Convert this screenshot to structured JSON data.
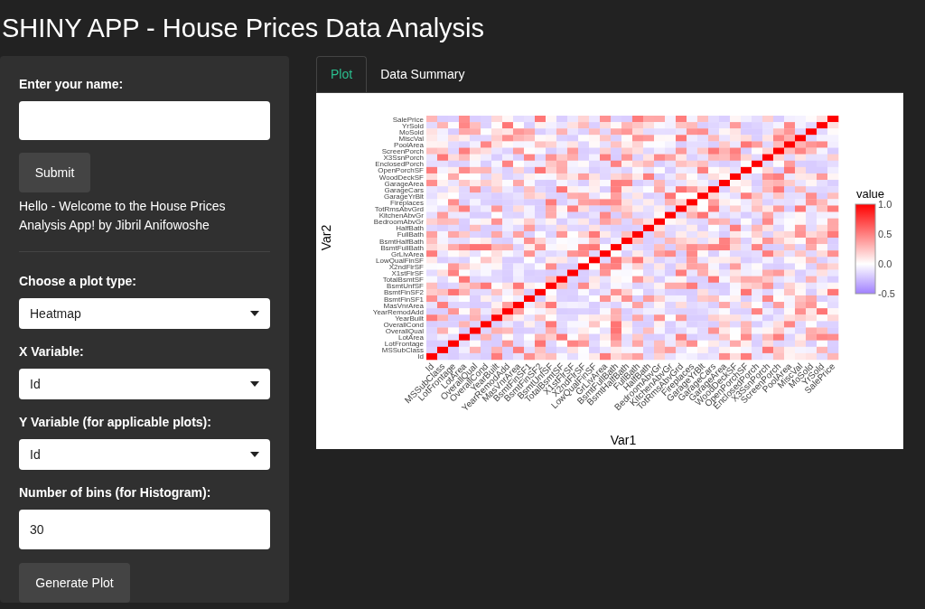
{
  "title": "SHINY APP - House Prices Data Analysis",
  "sidebar": {
    "name_label": "Enter your name:",
    "submit": "Submit",
    "greeting": "Hello - Welcome to the House Prices Analysis App! by Jibril Anifowoshe",
    "controls": [
      {
        "kind": "select",
        "label": "Choose a plot type:",
        "value": "Heatmap"
      },
      {
        "kind": "select",
        "label": "X Variable:",
        "value": "Id"
      },
      {
        "kind": "select",
        "label": "Y Variable (for applicable plots):",
        "value": "Id"
      },
      {
        "kind": "input",
        "label": "Number of bins (for Histogram):",
        "value": "30"
      }
    ],
    "generate": "Generate Plot"
  },
  "tabs": [
    {
      "label": "Plot",
      "selected": true
    },
    {
      "label": "Data Summary",
      "selected": false
    }
  ],
  "heatmap": {
    "xlabel": "Var1",
    "ylabel": "Var2",
    "legend_title": "value",
    "legend_ticks": [
      "1.0",
      "0.5",
      "0.0",
      "-0.5"
    ],
    "y_labels": [
      "SalePrice",
      "YrSold",
      "MoSold",
      "MiscVal",
      "PoolArea",
      "ScreenPorch",
      "X3SsnPorch",
      "EnclosedPorch",
      "OpenPorchSF",
      "WoodDeckSF",
      "GarageArea",
      "GarageCars",
      "GarageYrBlt",
      "Fireplaces",
      "TotRmsAbvGrd",
      "KitchenAbvGr",
      "BedroomAbvGr",
      "HalfBath",
      "FullBath",
      "BsmtHalfBath",
      "BsmtFullBath",
      "GrLivArea",
      "LowQualFinSF",
      "X2ndFlrSF",
      "X1stFlrSF",
      "TotalBsmtSF",
      "BsmtUnfSF",
      "BsmtFinSF2",
      "BsmtFinSF1",
      "MasVnrArea",
      "YearRemodAdd",
      "YearBuilt",
      "OverallCond",
      "OverallQual",
      "LotArea",
      "LotFrontage",
      "MSSubClass",
      "Id"
    ],
    "x_labels": [
      "Id",
      "MSSubClass",
      "LotFrontage",
      "LotArea",
      "OverallQual",
      "OverallCond",
      "YearBuilt",
      "YearRemodAdd",
      "MasVnrArea",
      "BsmtFinSF1",
      "BsmtFinSF2",
      "BsmtUnfSF",
      "TotalBsmtSF",
      "X1stFlrSF",
      "X2ndFlrSF",
      "LowQualFinSF",
      "GrLivArea",
      "BsmtFullBath",
      "BsmtHalfBath",
      "FullBath",
      "HalfBath",
      "BedroomAbvGr",
      "KitchenAbvGr",
      "TotRmsAbvGrd",
      "Fireplaces",
      "GarageYrBlt",
      "GarageCars",
      "GarageArea",
      "WoodDeckSF",
      "OpenPorchSF",
      "EnclosedPorch",
      "X3SsnPorch",
      "ScreenPorch",
      "PoolArea",
      "MiscVal",
      "MoSold",
      "YrSold",
      "SalePrice"
    ]
  }
}
